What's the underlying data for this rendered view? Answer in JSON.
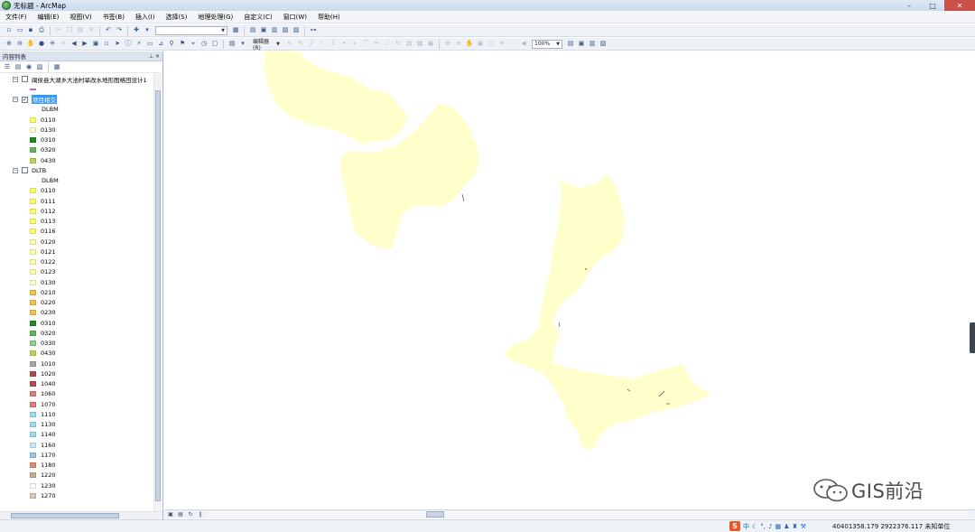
{
  "window": {
    "title": "无标题 - ArcMap"
  },
  "menu": [
    "文件(F)",
    "编辑(E)",
    "视图(V)",
    "书签(B)",
    "插入(I)",
    "选择(S)",
    "地理处理(G)",
    "自定义(C)",
    "窗口(W)",
    "帮助(H)"
  ],
  "toolbar": {
    "scale_value": "",
    "editor_label": "编辑器(R)",
    "zoom_level": "100%"
  },
  "toc": {
    "title": "内容列表",
    "layers": [
      {
        "name": "闽侯县大湖乡大池村旱改水地形图格田设计1",
        "checked": false,
        "expanded": true,
        "kind": "line"
      },
      {
        "name": "项目相交",
        "checked": true,
        "expanded": true,
        "selected": true,
        "field": "DLBM",
        "classes": [
          {
            "code": "0110",
            "color": "#ffff66"
          },
          {
            "code": "0130",
            "color": "#ffffcc"
          },
          {
            "code": "0310",
            "color": "#1f8c1f"
          },
          {
            "code": "0320",
            "color": "#5cb85c"
          },
          {
            "code": "0430",
            "color": "#b8d45a"
          }
        ]
      },
      {
        "name": "DLTB",
        "checked": false,
        "expanded": true,
        "field": "DLBM",
        "classes": [
          {
            "code": "0110",
            "color": "#ffff66"
          },
          {
            "code": "0111",
            "color": "#ffff66"
          },
          {
            "code": "0112",
            "color": "#ffff66"
          },
          {
            "code": "0113",
            "color": "#ffff66"
          },
          {
            "code": "0116",
            "color": "#ffff66"
          },
          {
            "code": "0120",
            "color": "#ffffa8"
          },
          {
            "code": "0121",
            "color": "#ffffa8"
          },
          {
            "code": "0122",
            "color": "#ffffa8"
          },
          {
            "code": "0123",
            "color": "#ffffa8"
          },
          {
            "code": "0130",
            "color": "#ffffcc"
          },
          {
            "code": "0210",
            "color": "#f2c24a"
          },
          {
            "code": "0220",
            "color": "#f2c24a"
          },
          {
            "code": "0230",
            "color": "#f2c24a"
          },
          {
            "code": "0310",
            "color": "#1f8c1f"
          },
          {
            "code": "0320",
            "color": "#5cb85c"
          },
          {
            "code": "0330",
            "color": "#8fd18f"
          },
          {
            "code": "0430",
            "color": "#b8d45a"
          },
          {
            "code": "1010",
            "color": "#a6a6a6"
          },
          {
            "code": "1020",
            "color": "#b34d4d"
          },
          {
            "code": "1040",
            "color": "#b34d4d"
          },
          {
            "code": "1060",
            "color": "#e07a7a"
          },
          {
            "code": "1070",
            "color": "#e07a7a"
          },
          {
            "code": "1110",
            "color": "#99ddf2"
          },
          {
            "code": "1130",
            "color": "#99ddf2"
          },
          {
            "code": "1140",
            "color": "#99ddf2"
          },
          {
            "code": "1160",
            "color": "#c2ecf7"
          },
          {
            "code": "1170",
            "color": "#99c4e6"
          },
          {
            "code": "1180",
            "color": "#e38a70"
          },
          {
            "code": "1220",
            "color": "#c9a98c"
          },
          {
            "code": "1230",
            "color": "#ffffff"
          },
          {
            "code": "1270",
            "color": "#d9c9b8"
          }
        ]
      }
    ]
  },
  "map": {
    "polygon_fill": "#ffffcc",
    "background": "#ffffff"
  },
  "statusbar": {
    "coordinates": "40401358.179  2922376.117 未知单位",
    "ime_logo": "S",
    "ime_mode": "中"
  },
  "watermark": {
    "text": "GIS前沿"
  }
}
